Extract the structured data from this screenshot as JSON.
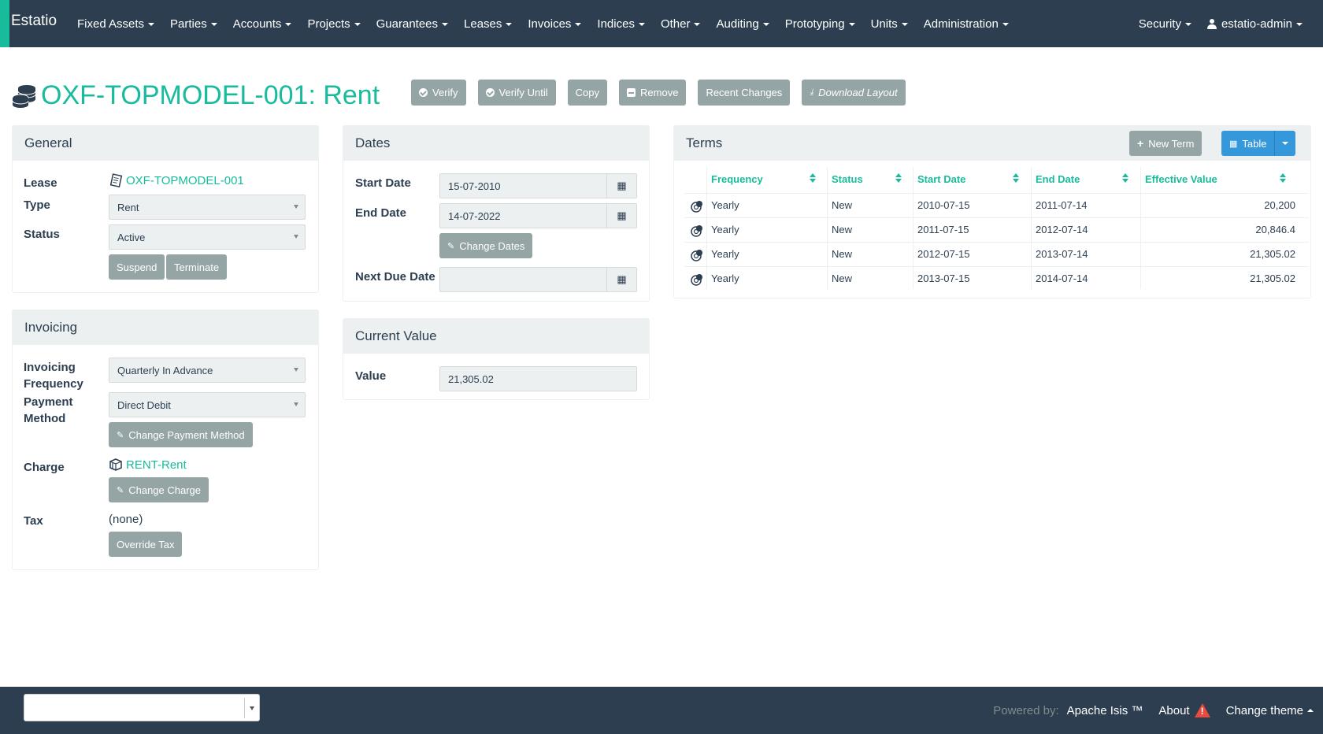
{
  "brand": "Estatio",
  "nav": {
    "left": [
      "Fixed Assets",
      "Parties",
      "Accounts",
      "Projects",
      "Guarantees",
      "Leases",
      "Invoices",
      "Indices",
      "Other",
      "Auditing",
      "Prototyping",
      "Units",
      "Administration"
    ],
    "security": "Security",
    "user": "estatio-admin"
  },
  "title": "OXF-TOPMODEL-001: Rent",
  "actions": {
    "verify": "Verify",
    "verify_until": "Verify Until",
    "copy": "Copy",
    "remove": "Remove",
    "recent_changes": "Recent Changes",
    "download_layout": "Download Layout"
  },
  "general": {
    "heading": "General",
    "lease_label": "Lease",
    "lease_value": "OXF-TOPMODEL-001",
    "type_label": "Type",
    "type_value": "Rent",
    "status_label": "Status",
    "status_value": "Active",
    "suspend": "Suspend",
    "terminate": "Terminate"
  },
  "invoicing": {
    "heading": "Invoicing",
    "freq_label_1": "Invoicing",
    "freq_label_2": "Frequency",
    "freq_value": "Quarterly In Advance",
    "pm_label_1": "Payment",
    "pm_label_2": "Method",
    "pm_value": "Direct Debit",
    "change_pm": "Change Payment Method",
    "charge_label": "Charge",
    "charge_value": "RENT-Rent",
    "change_charge": "Change Charge",
    "tax_label": "Tax",
    "tax_value": "(none)",
    "override_tax": "Override Tax"
  },
  "dates": {
    "heading": "Dates",
    "start_label": "Start Date",
    "start_value": "15-07-2010",
    "end_label": "End Date",
    "end_value": "14-07-2022",
    "change_dates": "Change Dates",
    "next_due_label": "Next Due Date",
    "next_due_value": ""
  },
  "current_value": {
    "heading": "Current Value",
    "value_label": "Value",
    "value": "21,305.02"
  },
  "terms": {
    "heading": "Terms",
    "new_term": "New Term",
    "table_view": "Table",
    "columns": [
      "Frequency",
      "Status",
      "Start Date",
      "End Date",
      "Effective Value"
    ],
    "rows": [
      {
        "frequency": "Yearly",
        "status": "New",
        "start": "2010-07-15",
        "end": "2011-07-14",
        "value": "20,200"
      },
      {
        "frequency": "Yearly",
        "status": "New",
        "start": "2011-07-15",
        "end": "2012-07-14",
        "value": "20,846.4"
      },
      {
        "frequency": "Yearly",
        "status": "New",
        "start": "2012-07-15",
        "end": "2013-07-14",
        "value": "21,305.02"
      },
      {
        "frequency": "Yearly",
        "status": "New",
        "start": "2013-07-15",
        "end": "2014-07-14",
        "value": "21,305.02"
      }
    ]
  },
  "footer": {
    "powered_by": "Powered by:",
    "apache": "Apache Isis ™",
    "about": "About",
    "change_theme": "Change theme"
  },
  "colors": {
    "nav_bg": "#2c3e50",
    "accent": "#18bc9c",
    "button_gray": "#95a5a6",
    "button_blue": "#3498db",
    "warning": "#e74c3c"
  }
}
